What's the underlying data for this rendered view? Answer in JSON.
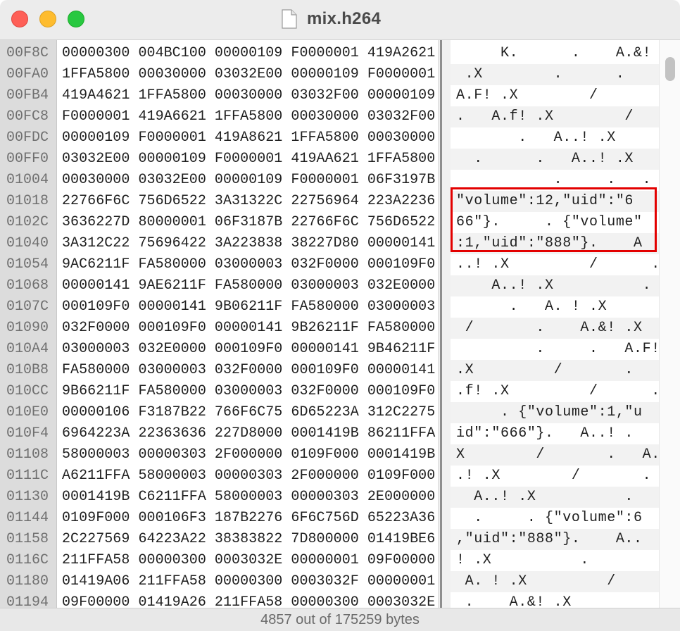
{
  "window": {
    "title": "mix.h264",
    "icons": {
      "close": "close-icon",
      "minimize": "minimize-icon",
      "maximize": "maximize-icon",
      "document": "document-icon"
    }
  },
  "colors": {
    "highlight_border": "#e30000",
    "gutter_bg": "#dcdcdc",
    "close": "#fe5f57",
    "minimize": "#febc2e",
    "maximize": "#28c840"
  },
  "rows": [
    {
      "offset": "00F8C",
      "hex": "00000300 004BC100 00000109 F0000001 419A2621",
      "ascii": "     K.      .    A.&!"
    },
    {
      "offset": "00FA0",
      "hex": "1FFA5800 00030000 03032E00 00000109 F0000001",
      "ascii": " .X        .      ."
    },
    {
      "offset": "00FB4",
      "hex": "419A4621 1FFA5800 00030000 03032F00 00000109",
      "ascii": "A.F! .X        /"
    },
    {
      "offset": "00FC8",
      "hex": "F0000001 419A6621 1FFA5800 00030000 03032F00",
      "ascii": ".   A.f! .X        /"
    },
    {
      "offset": "00FDC",
      "hex": "00000109 F0000001 419A8621 1FFA5800 00030000",
      "ascii": "       .   A..! .X"
    },
    {
      "offset": "00FF0",
      "hex": "03032E00 00000109 F0000001 419AA621 1FFA5800",
      "ascii": "  .      .   A..! .X"
    },
    {
      "offset": "01004",
      "hex": "00030000 03032E00 00000109 F0000001 06F3197B",
      "ascii": "           .     .   . {"
    },
    {
      "offset": "01018",
      "hex": "22766F6C 756D6522 3A31322C 22756964 223A2236",
      "ascii": "\"volume\":12,\"uid\":\"6"
    },
    {
      "offset": "0102C",
      "hex": "3636227D 80000001 06F3187B 22766F6C 756D6522",
      "ascii": "66\"}.     . {\"volume\""
    },
    {
      "offset": "01040",
      "hex": "3A312C22 75696422 3A223838 38227D80 00000141",
      "ascii": ":1,\"uid\":\"888\"}.    A"
    },
    {
      "offset": "01054",
      "hex": "9AC6211F FA580000 03000003 032F0000 000109F0",
      "ascii": "..! .X         /      ."
    },
    {
      "offset": "01068",
      "hex": "00000141 9AE6211F FA580000 03000003 032E0000",
      "ascii": "    A..! .X          ."
    },
    {
      "offset": "0107C",
      "hex": "000109F0 00000141 9B06211F FA580000 03000003",
      "ascii": "      .   A. ! .X"
    },
    {
      "offset": "01090",
      "hex": "032F0000 000109F0 00000141 9B26211F FA580000",
      "ascii": " /       .    A.&! .X"
    },
    {
      "offset": "010A4",
      "hex": "03000003 032E0000 000109F0 00000141 9B46211F",
      "ascii": "         .     .   A.F!"
    },
    {
      "offset": "010B8",
      "hex": "FA580000 03000003 032F0000 000109F0 00000141",
      "ascii": ".X         /       .   A"
    },
    {
      "offset": "010CC",
      "hex": "9B66211F FA580000 03000003 032F0000 000109F0",
      "ascii": ".f! .X         /      ."
    },
    {
      "offset": "010E0",
      "hex": "00000106 F3187B22 766F6C75 6D65223A 312C2275",
      "ascii": "     . {\"volume\":1,\"u"
    },
    {
      "offset": "010F4",
      "hex": "6964223A 22363636 227D8000 0001419B 86211FFA",
      "ascii": "id\":\"666\"}.   A..! ."
    },
    {
      "offset": "01108",
      "hex": "58000003 00000303 2F000000 0109F000 0001419B",
      "ascii": "X        /       .   A."
    },
    {
      "offset": "0111C",
      "hex": "A6211FFA 58000003 00000303 2F000000 0109F000",
      "ascii": ".! .X        /       ."
    },
    {
      "offset": "01130",
      "hex": "0001419B C6211FFA 58000003 00000303 2E000000",
      "ascii": "  A..! .X          ."
    },
    {
      "offset": "01144",
      "hex": "0109F000 000106F3 187B2276 6F6C756D 65223A36",
      "ascii": "  .     . {\"volume\":6"
    },
    {
      "offset": "01158",
      "hex": "2C227569 64223A22 38383822 7D800000 01419BE6",
      "ascii": ",\"uid\":\"888\"}.    A.."
    },
    {
      "offset": "0116C",
      "hex": "211FFA58 00000300 0003032E 00000001 09F00000",
      "ascii": "! .X          ."
    },
    {
      "offset": "01180",
      "hex": "01419A06 211FFA58 00000300 0003032F 00000001",
      "ascii": " A. ! .X         /"
    },
    {
      "offset": "01194",
      "hex": "09F00000 01419A26 211FFA58 00000300 0003032E",
      "ascii": " .    A.&! .X"
    }
  ],
  "status": {
    "text": "4857 out of 175259 bytes"
  }
}
